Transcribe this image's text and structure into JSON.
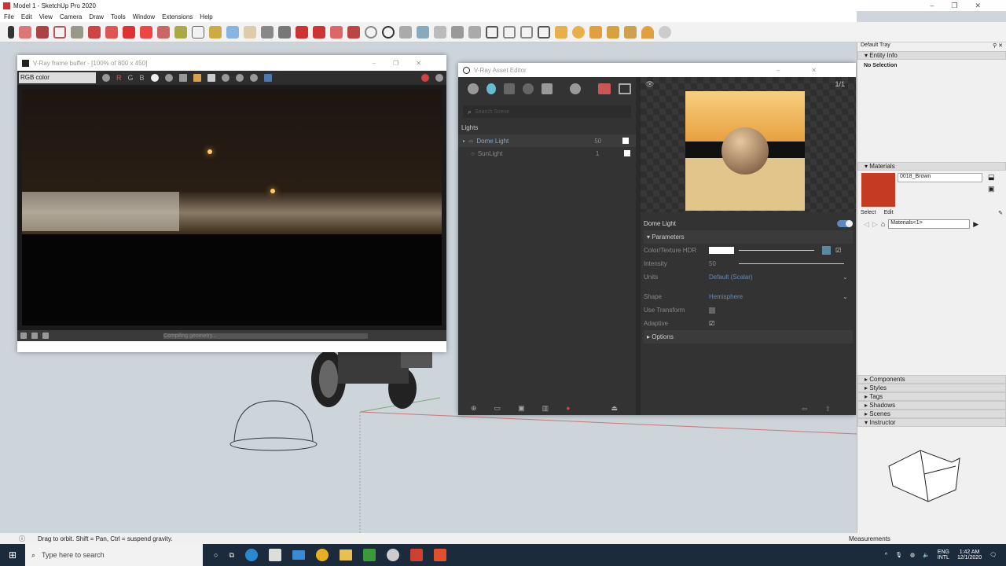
{
  "app": {
    "title": "Model 1 - SketchUp Pro 2020",
    "menu": [
      "File",
      "Edit",
      "View",
      "Camera",
      "Draw",
      "Tools",
      "Window",
      "Extensions",
      "Help"
    ]
  },
  "vfb": {
    "title": "V-Ray frame buffer - [100% of 800 x 450]",
    "channel": "RGB color",
    "channels": [
      "R",
      "G",
      "B"
    ],
    "status": "Compiling geometry..."
  },
  "asset_editor": {
    "title": "V-Ray Asset Editor",
    "search_placeholder": "Search Scene",
    "section": "Lights",
    "lights": [
      {
        "name": "Dome Light",
        "value": "50"
      },
      {
        "name": "SunLight",
        "value": "1"
      }
    ],
    "selected": "Dome Light",
    "enabled": true,
    "parameters_label": "Parameters",
    "preview_scale": "1/1",
    "params": [
      {
        "label": "Color/Texture HDR",
        "value": ""
      },
      {
        "label": "Intensity",
        "value": "50"
      },
      {
        "label": "Units",
        "value": "Default (Scalar)"
      },
      {
        "label": "Shape",
        "value": "Hemisphere"
      },
      {
        "label": "Use Transform",
        "value": ""
      },
      {
        "label": "Adaptive",
        "value": ""
      }
    ],
    "use_transform": false,
    "adaptive": true,
    "options_label": "Options"
  },
  "tray": {
    "title": "Default Tray",
    "entity_info": "Entity Info",
    "no_selection": "No Selection",
    "materials": "Materials",
    "material_name": "0018_Brown",
    "material_color": "#c43a22",
    "tab_select": "Select",
    "tab_edit": "Edit",
    "library": "Materials<1>",
    "panels": [
      "Components",
      "Styles",
      "Tags",
      "Shadows",
      "Scenes",
      "Instructor"
    ]
  },
  "status": {
    "hint": "Drag to orbit. Shift = Pan, Ctrl = suspend gravity.",
    "measurements": "Measurements"
  },
  "taskbar": {
    "search": "Type here to search",
    "lang1": "ENG",
    "lang2": "INTL",
    "time": "1:42 AM",
    "date": "12/1/2020"
  }
}
